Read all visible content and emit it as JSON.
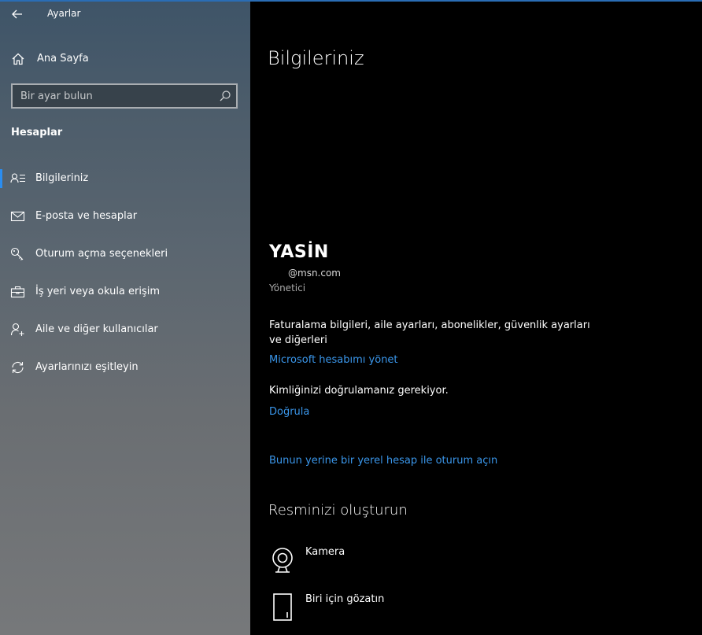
{
  "window": {
    "title": "Ayarlar"
  },
  "sidebar": {
    "home_label": "Ana Sayfa",
    "search": {
      "placeholder": "Bir ayar bulun",
      "value": ""
    },
    "section_title": "Hesaplar",
    "items": [
      {
        "label": "Bilgileriniz",
        "icon": "person-list-icon",
        "active": true
      },
      {
        "label": "E-posta ve hesaplar",
        "icon": "mail-icon",
        "active": false
      },
      {
        "label": "Oturum açma seçenekleri",
        "icon": "key-icon",
        "active": false
      },
      {
        "label": "İş yeri veya okula erişim",
        "icon": "briefcase-icon",
        "active": false
      },
      {
        "label": "Aile ve diğer kullanıcılar",
        "icon": "add-person-icon",
        "active": false
      },
      {
        "label": "Ayarlarınızı eşitleyin",
        "icon": "sync-icon",
        "active": false
      }
    ]
  },
  "main": {
    "title": "Bilgileriniz",
    "user": {
      "name": "YASİN",
      "email": "@msn.com",
      "role": "Yönetici"
    },
    "billing_text": "Faturalama bilgileri, aile ayarları, abonelikler, güvenlik ayarları ve diğerleri",
    "manage_account_link": "Microsoft hesabımı yönet",
    "verify_text": "Kimliğinizi doğrulamanız gerekiyor.",
    "verify_link": "Doğrula",
    "local_account_link": "Bunun yerine bir yerel hesap ile oturum açın",
    "picture_section_title": "Resminizi oluşturun",
    "picture_options": [
      {
        "label": "Kamera",
        "icon": "camera-icon"
      },
      {
        "label": "Biri için gözatın",
        "icon": "browse-icon"
      }
    ]
  },
  "colors": {
    "accent": "#2a8df0",
    "link": "#3a96ea"
  }
}
